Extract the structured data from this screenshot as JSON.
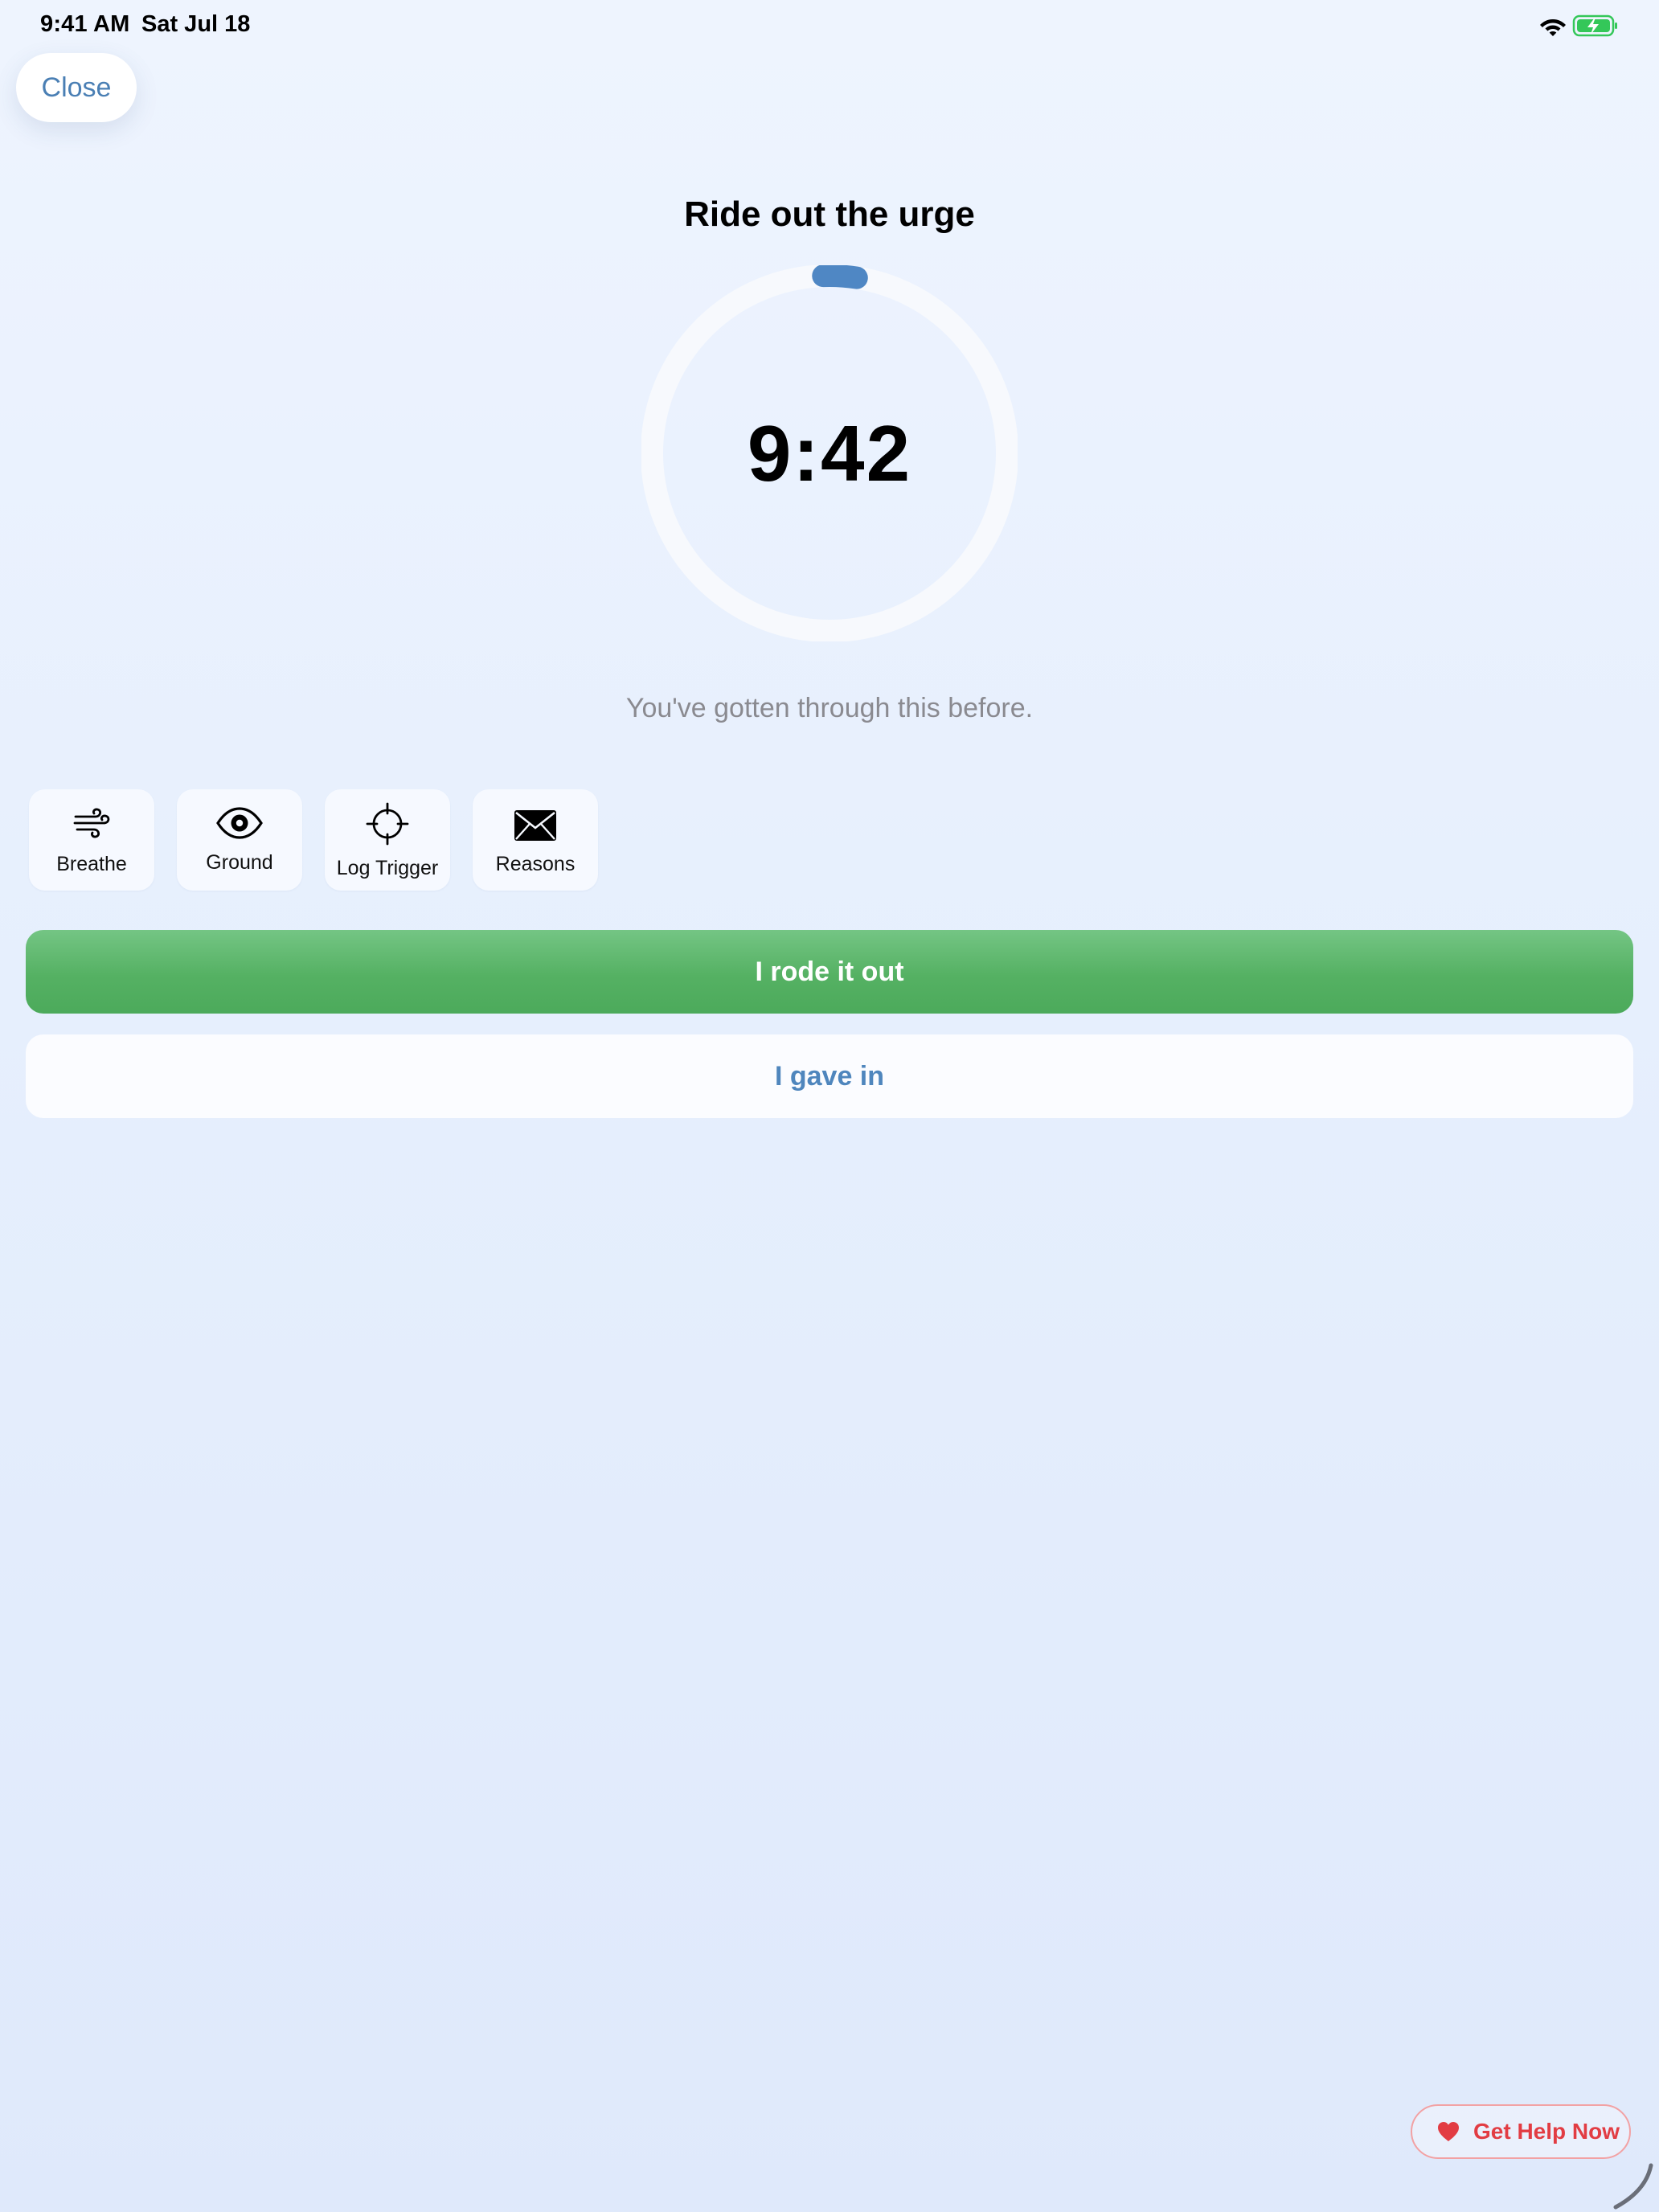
{
  "status_bar": {
    "time": "9:41 AM",
    "date": "Sat Jul 18",
    "icons": [
      "wifi-icon",
      "battery-charging-icon"
    ],
    "battery_color": "#34c759"
  },
  "close_button": {
    "label": "Close"
  },
  "title": "Ride out the urge",
  "timer": {
    "display": "9:42",
    "progress_fraction": 0.03,
    "ring_color": "#f7f9fd",
    "progress_color": "#4f87c4"
  },
  "encouragement": "You've gotten through this before.",
  "tools": [
    {
      "label": "Breathe",
      "icon": "wind-icon"
    },
    {
      "label": "Ground",
      "icon": "eye-icon"
    },
    {
      "label": "Log Trigger",
      "icon": "crosshair-icon"
    },
    {
      "label": "Reasons",
      "icon": "envelope-icon"
    }
  ],
  "actions": {
    "primary_label": "I rode it out",
    "secondary_label": "I gave in",
    "primary_color": "#55b163",
    "secondary_text_color": "#4f86bd"
  },
  "help_button": {
    "label": "Get Help Now",
    "icon": "heart-icon",
    "color": "#e23c43"
  }
}
